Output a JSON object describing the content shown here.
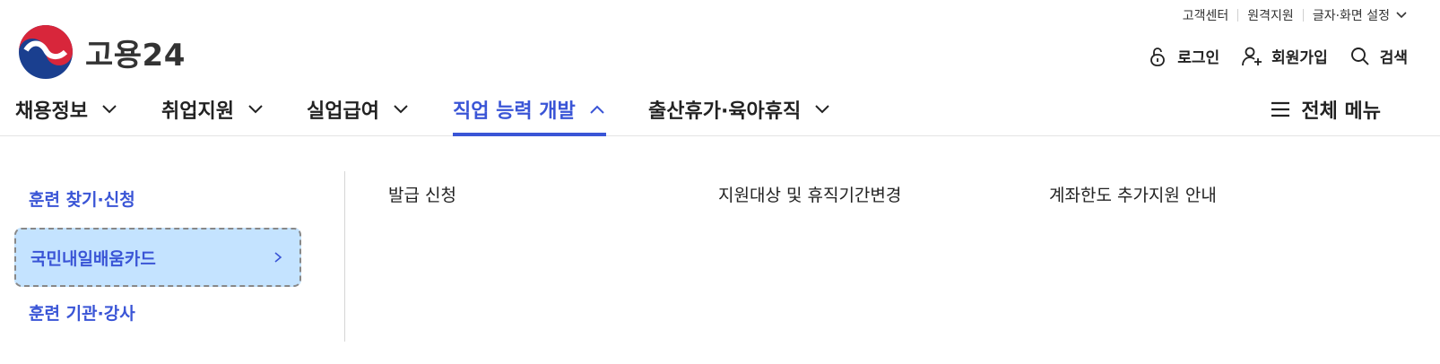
{
  "utility": {
    "customer_center": "고객센터",
    "remote_support": "원격지원",
    "text_screen_settings": "글자·화면 설정"
  },
  "logo": {
    "text": "고용24"
  },
  "account": {
    "login": "로그인",
    "signup": "회원가입",
    "search": "검색"
  },
  "nav": {
    "items": [
      {
        "label": "채용정보",
        "icon": "chevron-down-icon"
      },
      {
        "label": "취업지원",
        "icon": "chevron-down-icon"
      },
      {
        "label": "실업급여",
        "icon": "chevron-down-icon"
      },
      {
        "label": "직업 능력 개발",
        "icon": "chevron-up-icon",
        "active": true
      },
      {
        "label": "출산휴가·육아휴직",
        "icon": "chevron-down-icon"
      }
    ],
    "all_menu": "전체 메뉴"
  },
  "submenu": {
    "side_items": [
      {
        "label": "훈련 찾기·신청"
      },
      {
        "label": "국민내일배움카드",
        "selected": true
      },
      {
        "label": "훈련 기관·강사"
      }
    ],
    "links": [
      "발급 신청",
      "지원대상 및 휴직기간변경",
      "계좌한도 추가지원 안내"
    ]
  },
  "colors": {
    "accent": "#3a55d6",
    "selected_bg": "#c4e3ff",
    "logo_red": "#d8263b",
    "logo_blue": "#1a3f8f"
  }
}
